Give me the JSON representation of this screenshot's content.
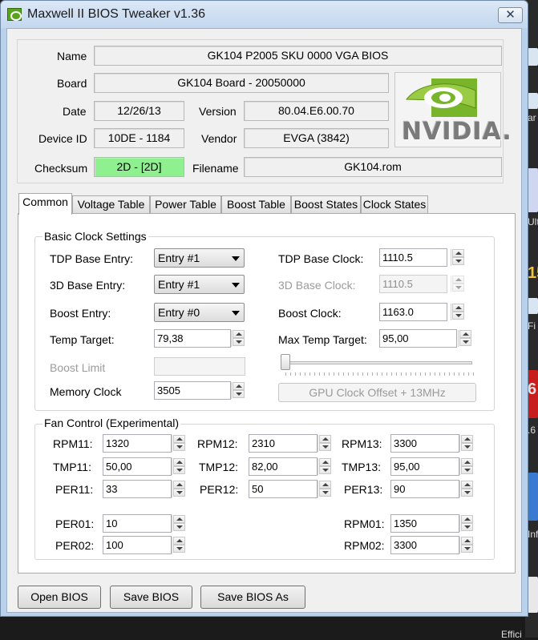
{
  "window": {
    "title": "Maxwell II BIOS Tweaker v1.36",
    "close_icon": "close-icon"
  },
  "info": {
    "name_label": "Name",
    "name_value": "GK104 P2005 SKU 0000 VGA BIOS",
    "board_label": "Board",
    "board_value": "GK104 Board - 20050000",
    "date_label": "Date",
    "date_value": "12/26/13",
    "version_label": "Version",
    "version_value": "80.04.E6.00.70",
    "device_label": "Device ID",
    "device_value": "10DE - 1184",
    "vendor_label": "Vendor",
    "vendor_value": "EVGA (3842)",
    "checksum_label": "Checksum",
    "checksum_value": "2D - [2D]",
    "filename_label": "Filename",
    "filename_value": "GK104.rom",
    "logo_text": "NVIDIA.",
    "checksum_color": "#8ff08f"
  },
  "tabs": [
    "Common",
    "Voltage Table",
    "Power Table",
    "Boost Table",
    "Boost States",
    "Clock States"
  ],
  "basic": {
    "title": "Basic Clock Settings",
    "tdp_base_entry_label": "TDP Base Entry:",
    "tdp_base_entry_value": "Entry #1",
    "d3_base_entry_label": "3D Base Entry:",
    "d3_base_entry_value": "Entry #1",
    "boost_entry_label": "Boost Entry:",
    "boost_entry_value": "Entry #0",
    "temp_target_label": "Temp Target:",
    "temp_target_value": "79,38",
    "boost_limit_label": "Boost Limit",
    "memory_clock_label": "Memory Clock",
    "memory_clock_value": "3505",
    "tdp_base_clock_label": "TDP Base Clock:",
    "tdp_base_clock_value": "1110.5",
    "d3_base_clock_label": "3D Base Clock:",
    "d3_base_clock_value": "1110.5",
    "boost_clock_label": "Boost Clock:",
    "boost_clock_value": "1163.0",
    "max_temp_label": "Max Temp Target:",
    "max_temp_value": "95,00",
    "offset_button": "GPU Clock Offset + 13MHz"
  },
  "fan": {
    "title": "Fan Control (Experimental)",
    "rpm11_label": "RPM11:",
    "rpm11_value": "1320",
    "rpm12_label": "RPM12:",
    "rpm12_value": "2310",
    "rpm13_label": "RPM13:",
    "rpm13_value": "3300",
    "tmp11_label": "TMP11:",
    "tmp11_value": "50,00",
    "tmp12_label": "TMP12:",
    "tmp12_value": "82,00",
    "tmp13_label": "TMP13:",
    "tmp13_value": "95,00",
    "per11_label": "PER11:",
    "per11_value": "33",
    "per12_label": "PER12:",
    "per12_value": "50",
    "per13_label": "PER13:",
    "per13_value": "90",
    "per01_label": "PER01:",
    "per01_value": "10",
    "per02_label": "PER02:",
    "per02_value": "100",
    "rpm01_label": "RPM01:",
    "rpm01_value": "1350",
    "rpm02_label": "RPM02:",
    "rpm02_value": "3300"
  },
  "buttons": {
    "open": "Open BIOS",
    "save": "Save BIOS",
    "save_as": "Save BIOS As"
  },
  "desktop": {
    "text_1": "ar",
    "text_2": "Ult",
    "text_3": "15",
    "text_4": "Fi",
    "text_5": "6",
    "text_6": ".6",
    "text_7": "Inf",
    "text_8": "Effici"
  }
}
